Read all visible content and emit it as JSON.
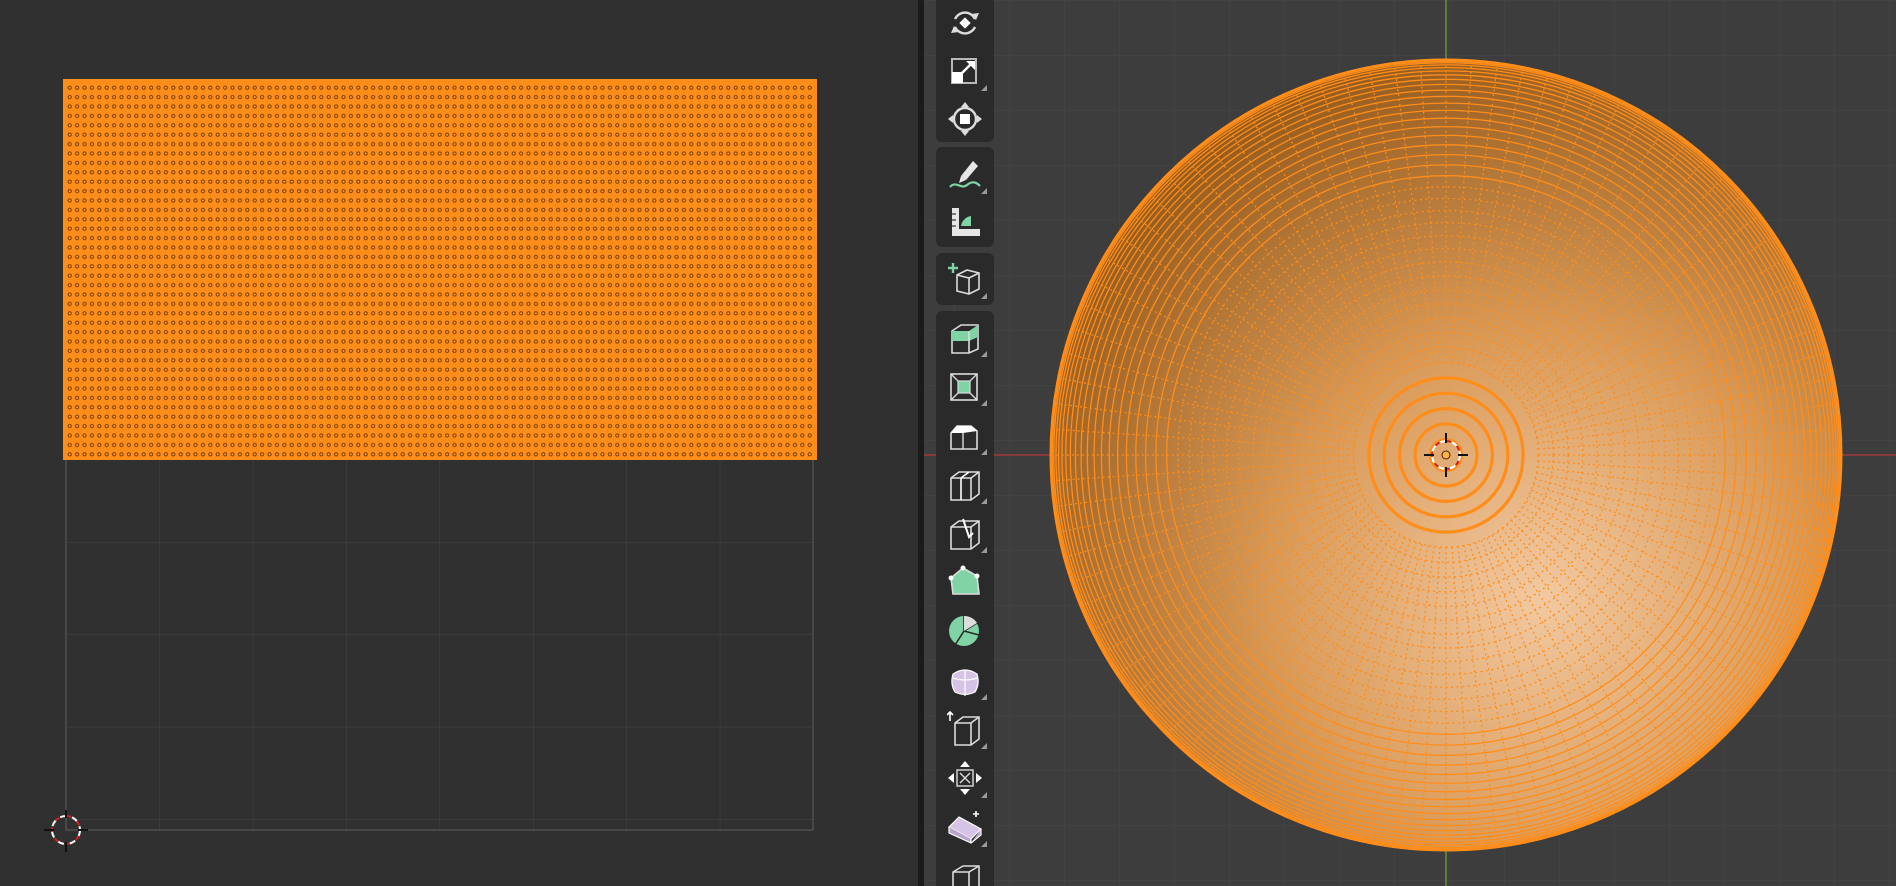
{
  "colors": {
    "uv_background": "#303030",
    "viewport_background": "#3d3d3d",
    "selection_orange": "#ff8d1a",
    "grid_line": "#454545",
    "toolbar_background": "#2a2a2a",
    "x_axis_red": "#b33a3a",
    "y_axis_green": "#6ea83a"
  },
  "uv_editor": {
    "grid_columns": 8,
    "grid_rows": 8,
    "selected_uv_rows": 44,
    "selected_uv_columns": 90
  },
  "viewport": {
    "mesh": "sphere-top-view",
    "radial_segments": 96,
    "rings": 40,
    "all_vertices_selected": true
  },
  "toolbar": {
    "tools": [
      {
        "id": "rotate",
        "icon": "rotate-icon"
      },
      {
        "id": "scale",
        "icon": "scale-icon"
      },
      {
        "id": "transform",
        "icon": "transform-icon"
      },
      {
        "id": "annotate",
        "icon": "annotate-icon"
      },
      {
        "id": "measure",
        "icon": "measure-icon"
      },
      {
        "id": "add-cube",
        "icon": "add-cube-icon"
      },
      {
        "id": "extrude-region",
        "icon": "extrude-region-icon"
      },
      {
        "id": "inset-faces",
        "icon": "inset-faces-icon"
      },
      {
        "id": "bevel",
        "icon": "bevel-icon"
      },
      {
        "id": "loop-cut",
        "icon": "loop-cut-icon"
      },
      {
        "id": "knife",
        "icon": "knife-icon"
      },
      {
        "id": "poly-build",
        "icon": "poly-build-icon"
      },
      {
        "id": "spin",
        "icon": "spin-icon"
      },
      {
        "id": "smooth",
        "icon": "smooth-icon"
      },
      {
        "id": "edge-slide",
        "icon": "edge-slide-icon"
      },
      {
        "id": "shrink-fatten",
        "icon": "shrink-fatten-icon"
      },
      {
        "id": "shear",
        "icon": "shear-icon"
      },
      {
        "id": "rip-region",
        "icon": "rip-region-icon"
      }
    ]
  }
}
